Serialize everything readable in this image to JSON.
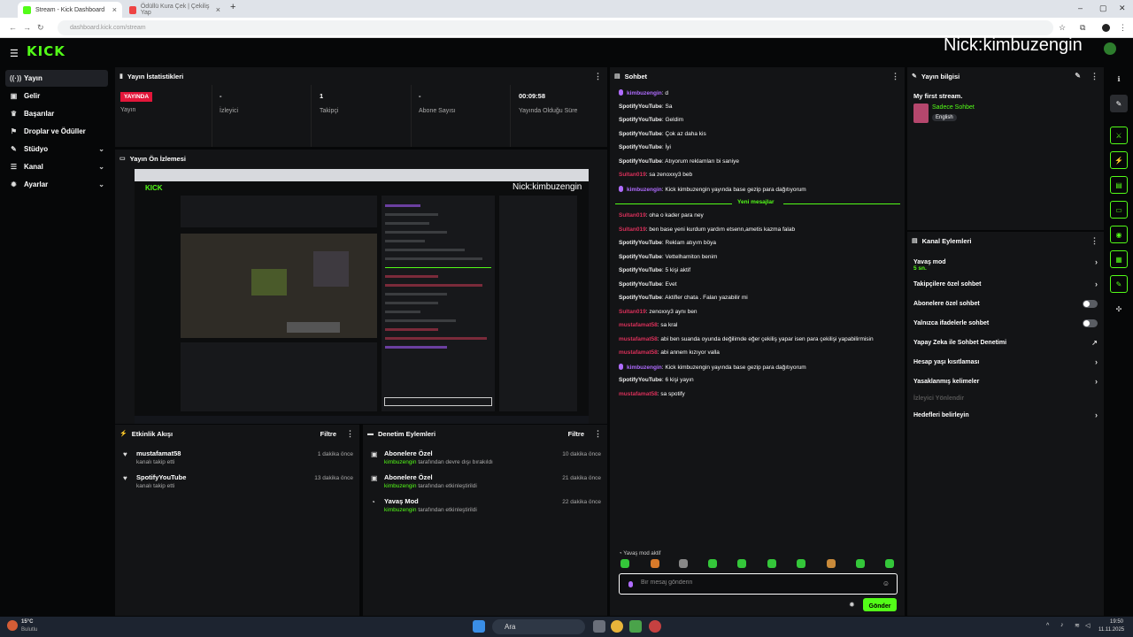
{
  "browser": {
    "tabs": [
      {
        "title": "Stream - Kick Dashboard",
        "favicon_color": "#53fc18"
      },
      {
        "title": "Ödüllü Kura Çek | Çekiliş Yap",
        "favicon_color": "#e44"
      }
    ],
    "url": "dashboard.kick.com/stream"
  },
  "app": {
    "logo": "KICK",
    "overlay_name": "Nick:kimbuzengin"
  },
  "sidebar": {
    "items": [
      {
        "label": "Yayın",
        "icon": "broadcast-icon",
        "glyph": "((·))"
      },
      {
        "label": "Gelir",
        "icon": "wallet-icon",
        "glyph": "▣"
      },
      {
        "label": "Başarılar",
        "icon": "trophy-icon",
        "glyph": "♛"
      },
      {
        "label": "Droplar ve Ödüller",
        "icon": "gift-icon",
        "glyph": "⚑"
      },
      {
        "label": "Stüdyo",
        "icon": "studio-icon",
        "glyph": "✎"
      },
      {
        "label": "Kanal",
        "icon": "users-icon",
        "glyph": "☰"
      },
      {
        "label": "Ayarlar",
        "icon": "gear-icon",
        "glyph": "✹"
      }
    ]
  },
  "stats": {
    "title": "Yayın İstatistikleri",
    "live_badge": "YAYINDA",
    "live_label": "Yayın",
    "items": [
      {
        "value": "-",
        "label": "İzleyici"
      },
      {
        "value": "1",
        "label": "Takipçi"
      },
      {
        "value": "-",
        "label": "Abone Sayısı"
      },
      {
        "value": "00:09:58",
        "label": "Yayında Olduğu Süre"
      }
    ]
  },
  "preview": {
    "title": "Yayın Ön İzlemesi",
    "inner_logo": "KICK",
    "inner_overlay": "Nick:kimbuzengin"
  },
  "activity": {
    "title": "Etkinlik Akışı",
    "filter": "Filtre",
    "events": [
      {
        "name": "mustafamat58",
        "desc": "kanalı takip etti",
        "time": "1 dakika önce"
      },
      {
        "name": "SpotifyYouTube",
        "desc": "kanalı takip etti",
        "time": "13 dakika önce"
      }
    ]
  },
  "moderation": {
    "title": "Denetim Eylemleri",
    "filter": "Filtre",
    "events": [
      {
        "name": "Abonelere Özel",
        "user": "kimbuzengin",
        "desc": "tarafından devre dışı bırakıldı",
        "time": "10 dakika önce"
      },
      {
        "name": "Abonelere Özel",
        "user": "kimbuzengin",
        "desc": "tarafından etkinleştirildi",
        "time": "21 dakika önce"
      },
      {
        "name": "Yavaş Mod",
        "user": "kimbuzengin",
        "desc": "tarafından etkinleştirildi",
        "time": "22 dakika önce"
      }
    ]
  },
  "chat": {
    "title": "Sohbet",
    "messages_before": [
      {
        "user": "kimbuzengin",
        "color": "purple",
        "text": "d"
      },
      {
        "user": "SpotifyYouTube",
        "color": "white",
        "text": "Sa"
      },
      {
        "user": "SpotifyYouTube",
        "color": "white",
        "text": "Geldim"
      },
      {
        "user": "SpotifyYouTube",
        "color": "white",
        "text": "Çok az daha kis"
      },
      {
        "user": "SpotifyYouTube",
        "color": "white",
        "text": "İyi"
      },
      {
        "user": "SpotifyYouTube",
        "color": "white",
        "text": "Atıyorum reklamları bi saniye"
      },
      {
        "user": "Sultan019",
        "color": "red",
        "text": "sa zenoxxy3 beb"
      },
      {
        "user": "kimbuzengin",
        "color": "purple",
        "text": "Kick kimbuzengin yayında base gezip para dağıtıyorum"
      }
    ],
    "new_messages": "Yeni mesajlar",
    "messages_after": [
      {
        "user": "Sultan019",
        "color": "red",
        "text": "oha o kader para ney"
      },
      {
        "user": "Sultan019",
        "color": "red",
        "text": "ben base yeni kurdum yardım etsenn,ametis kazma falab"
      },
      {
        "user": "SpotifyYouTube",
        "color": "white",
        "text": "Reklam atıyım böya"
      },
      {
        "user": "SpotifyYouTube",
        "color": "white",
        "text": "Vettelhamiton benim"
      },
      {
        "user": "SpotifyYouTube",
        "color": "white",
        "text": "5 kişi aktif"
      },
      {
        "user": "SpotifyYouTube",
        "color": "white",
        "text": "Evet"
      },
      {
        "user": "SpotifyYouTube",
        "color": "white",
        "text": "Aktifler chata . Falan yazabilir mi"
      },
      {
        "user": "Sultan019",
        "color": "red",
        "text": "zenoxxy3 aynı ben"
      },
      {
        "user": "mustafamat58",
        "color": "red",
        "text": "sa kral"
      },
      {
        "user": "mustafamat58",
        "color": "red",
        "text": "abi ben suanda oyunda değilimde eğer çekiliş yapar isen para çekilişi yapabilirmisin"
      },
      {
        "user": "mustafamat58",
        "color": "red",
        "text": "abi annem kızıyor valla"
      },
      {
        "user": "kimbuzengin",
        "color": "purple",
        "text": "Kick kimbuzengin yayında base gezip para dağıtıyorum"
      },
      {
        "user": "SpotifyYouTube",
        "color": "white",
        "text": "6 kişi yayın"
      },
      {
        "user": "mustafamat58",
        "color": "red",
        "text": "sa spotify"
      }
    ],
    "slow_mode": "Yavaş mod aktif",
    "placeholder": "Bir mesaj gönderin",
    "send": "Gönder"
  },
  "stream_info": {
    "title": "Yayın bilgisi",
    "stream_title": "My first stream.",
    "category": "Sadece Sohbet",
    "language": "English"
  },
  "channel_actions": {
    "title": "Kanal Eylemleri",
    "items": [
      {
        "label": "Yavaş mod",
        "sub": "5 sn.",
        "control": "chevron"
      },
      {
        "label": "Takipçilere özel sohbet",
        "control": "chevron"
      },
      {
        "label": "Abonelere özel sohbet",
        "control": "toggle"
      },
      {
        "label": "Yalnızca ifadelerle sohbet",
        "control": "toggle"
      },
      {
        "label": "Yapay Zeka ile Sohbet Denetimi",
        "control": "external"
      },
      {
        "label": "Hesap yaşı kısıtlaması",
        "control": "chevron"
      },
      {
        "label": "Yasaklanmış kelimeler",
        "control": "chevron"
      },
      {
        "label": "İzleyici Yönlendir",
        "control": "none",
        "disabled": true
      },
      {
        "label": "Hedefleri belirleyin",
        "control": "chevron"
      }
    ]
  },
  "taskbar": {
    "weather_temp": "15°C",
    "weather_desc": "Bulutlu",
    "search": "Ara",
    "time": "19:50",
    "date": "11.11.2025"
  }
}
